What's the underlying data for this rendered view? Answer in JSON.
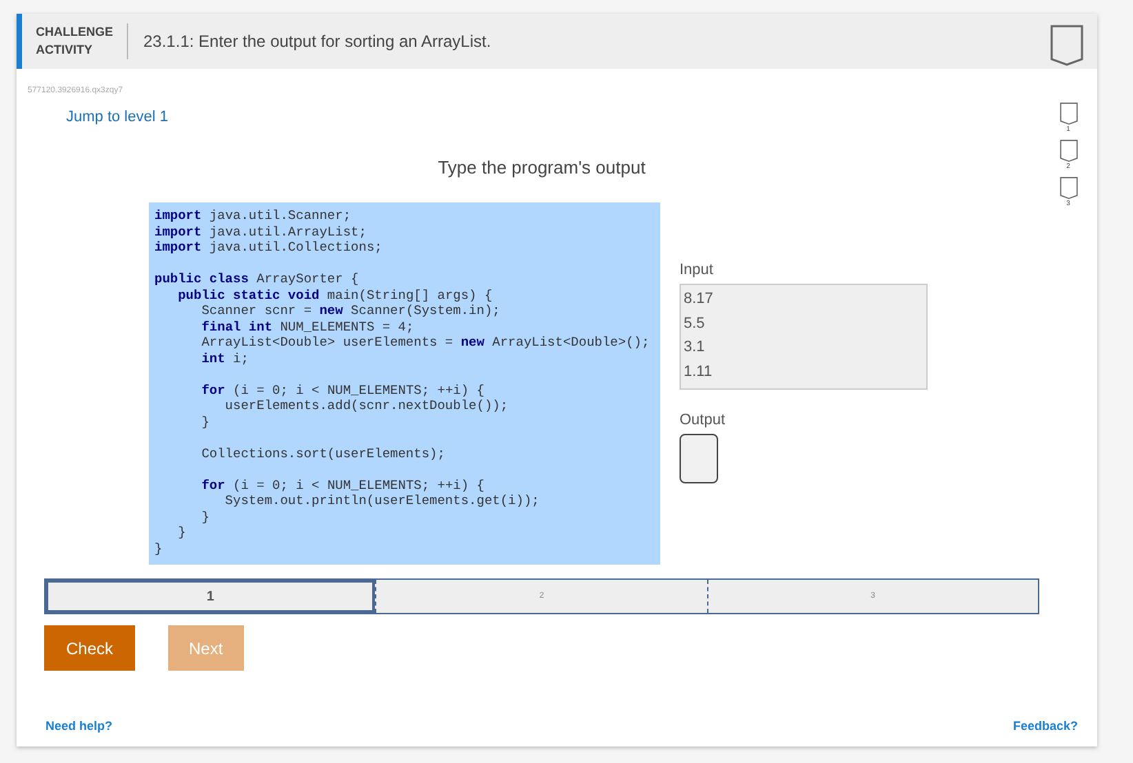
{
  "header": {
    "label": "CHALLENGE ACTIVITY",
    "title": "23.1.1: Enter the output for sorting an ArrayList."
  },
  "activity_id": "577120.3926916.qx3zqy7",
  "jump_link": "Jump to level 1",
  "level_badges": [
    {
      "label": "1"
    },
    {
      "label": "2"
    },
    {
      "label": "3"
    }
  ],
  "prompt": "Type the program's output",
  "code_blocks": [
    [
      "**import** java.util.Scanner;",
      "**import** java.util.ArrayList;",
      "**import** java.util.Collections;"
    ],
    [
      "**public class** ArraySorter {",
      "   **public static void** main(String[] args) {",
      "      Scanner scnr = **new** Scanner(System.in);",
      "      **final int** NUM_ELEMENTS = 4;",
      "      ArrayList<Double> userElements = **new** ArrayList<Double>();",
      "      **int** i;"
    ],
    [
      "      **for** (i = 0; i < NUM_ELEMENTS; ++i) {",
      "         userElements.add(scnr.nextDouble());",
      "      }"
    ],
    [
      "      Collections.sort(userElements);"
    ],
    [
      "      **for** (i = 0; i < NUM_ELEMENTS; ++i) {",
      "         System.out.println(userElements.get(i));",
      "      }",
      "   }",
      "}"
    ]
  ],
  "input": {
    "label": "Input",
    "lines": [
      "8.17",
      "5.5",
      "3.1",
      "1.11"
    ]
  },
  "output": {
    "label": "Output"
  },
  "levels": [
    {
      "label": "1",
      "selected": true
    },
    {
      "label": "2",
      "selected": false
    },
    {
      "label": "3",
      "selected": false
    }
  ],
  "buttons": [
    {
      "label": "Check",
      "disabled": false
    },
    {
      "label": "Next",
      "disabled": true
    }
  ],
  "footer": {
    "help": "Need help?",
    "feedback": "Feedback?"
  }
}
